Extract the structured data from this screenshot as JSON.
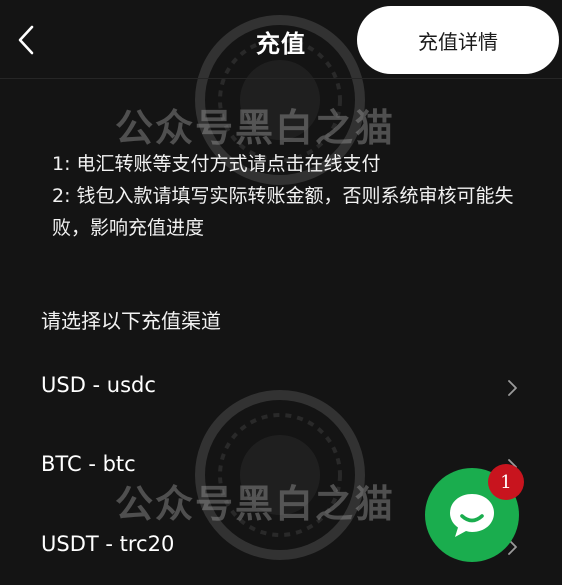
{
  "header": {
    "title": "充值",
    "details_button": "充值详情"
  },
  "watermark": {
    "text": "公众号黑白之猫"
  },
  "notice": {
    "line1": "1: 电汇转账等支付方式请点击在线支付",
    "line2": "2: 钱包入款请填写实际转账金额，否则系统审核可能失败，影响充值进度"
  },
  "channels": {
    "heading": "请选择以下充值渠道",
    "items": [
      {
        "label": "USD - usdc"
      },
      {
        "label": "BTC - btc"
      },
      {
        "label": "USDT - trc20"
      }
    ]
  },
  "chat": {
    "badge_count": "1"
  },
  "colors": {
    "background": "#141414",
    "chat_button": "#1aad4e",
    "badge": "#c8141e",
    "details_button_bg": "#ffffff"
  },
  "icons": {
    "back": "chevron-left-icon",
    "channel_arrow": "chevron-right-icon",
    "chat": "chat-bubble-icon"
  }
}
